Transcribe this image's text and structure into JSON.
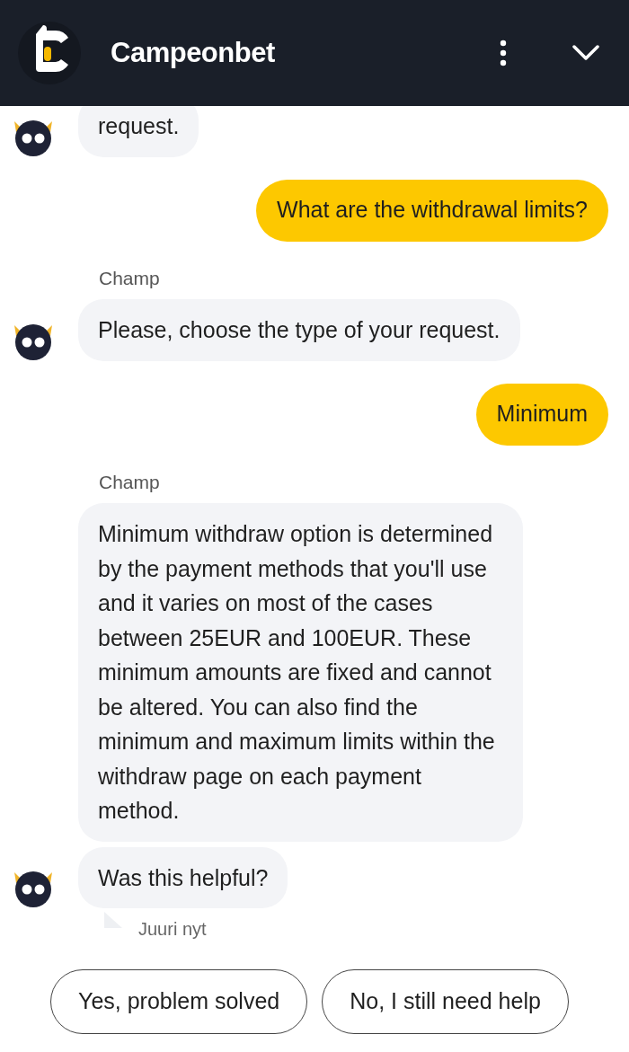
{
  "header": {
    "title": "Campeonbet"
  },
  "messages": [
    {
      "kind": "bot",
      "bubbles": [
        "request."
      ]
    },
    {
      "kind": "user",
      "text": "What are the withdrawal limits?"
    },
    {
      "kind": "bot",
      "sender": "Champ",
      "bubbles": [
        "Please, choose the type of your request."
      ]
    },
    {
      "kind": "user",
      "text": "Minimum"
    },
    {
      "kind": "bot",
      "sender": "Champ",
      "bubbles": [
        "Minimum withdraw option is determined by the payment methods that you'll use and it varies on most of the cases between 25EUR and 100EUR. These minimum amounts are fixed and cannot be altered. You can also find the minimum and maximum limits within the withdraw page on each payment method.",
        "Was this helpful?"
      ],
      "time": "Juuri nyt"
    }
  ],
  "quick_replies": [
    "Yes, problem solved",
    "No, I still need help"
  ]
}
